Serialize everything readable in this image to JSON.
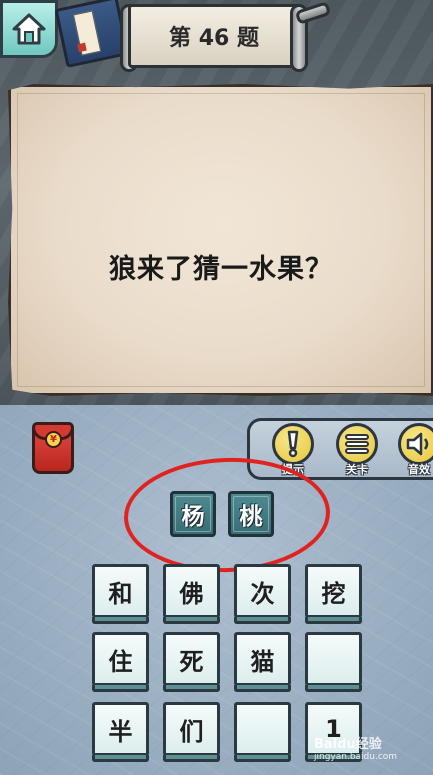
{
  "header": {
    "level_title": "第 46 题"
  },
  "question": {
    "text": "狼来了猜一水果？"
  },
  "toolbar": {
    "items": [
      {
        "label": "提示",
        "icon": "exclamation-icon"
      },
      {
        "label": "关卡",
        "icon": "list-icon"
      },
      {
        "label": "音效",
        "icon": "speaker-icon"
      }
    ]
  },
  "answer": [
    "杨",
    "桃"
  ],
  "tiles": [
    [
      "和",
      "佛",
      "次",
      "挖"
    ],
    [
      "住",
      "死",
      "猫",
      ""
    ],
    [
      "半",
      "们",
      "",
      "1"
    ]
  ],
  "redpacket": {
    "symbol": "¥"
  },
  "watermark": {
    "line1": "Baidu经验",
    "line2": "jingyan.baidu.com"
  },
  "colors": {
    "highlight_ellipse": "#e0231f",
    "answer_box": "#3a6d75",
    "toolbar_disc": "#e6c63c"
  }
}
